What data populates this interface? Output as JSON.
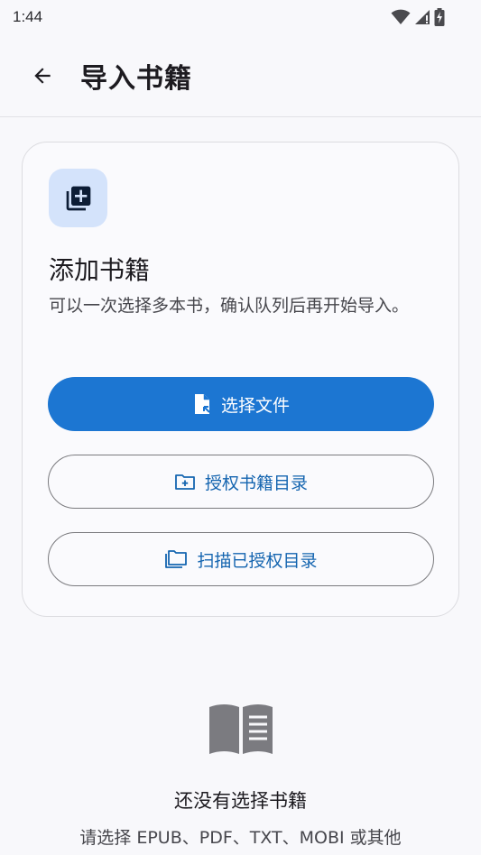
{
  "status_bar": {
    "time": "1:44",
    "icons": [
      "wifi-icon",
      "signal-icon",
      "battery-charging-icon"
    ]
  },
  "app_bar": {
    "back_icon": "arrow-back-icon",
    "title": "导入书籍"
  },
  "add_card": {
    "icon": "library-add-icon",
    "title": "添加书籍",
    "description": "可以一次选择多本书，确认队列后再开始导入。",
    "buttons": {
      "select_files": {
        "label": "选择文件",
        "icon": "file-open-icon"
      },
      "authorize_folder": {
        "label": "授权书籍目录",
        "icon": "folder-add-icon"
      },
      "scan_folders": {
        "label": "扫描已授权目录",
        "icon": "folders-icon"
      }
    }
  },
  "empty_state": {
    "icon": "open-book-icon",
    "title": "还没有选择书籍",
    "description": "请选择 EPUB、PDF、TXT、MOBI 或其他"
  },
  "colors": {
    "primary": "#1c76d2",
    "primary_text": "#1565b0",
    "icon_container": "#d4e3fb"
  }
}
